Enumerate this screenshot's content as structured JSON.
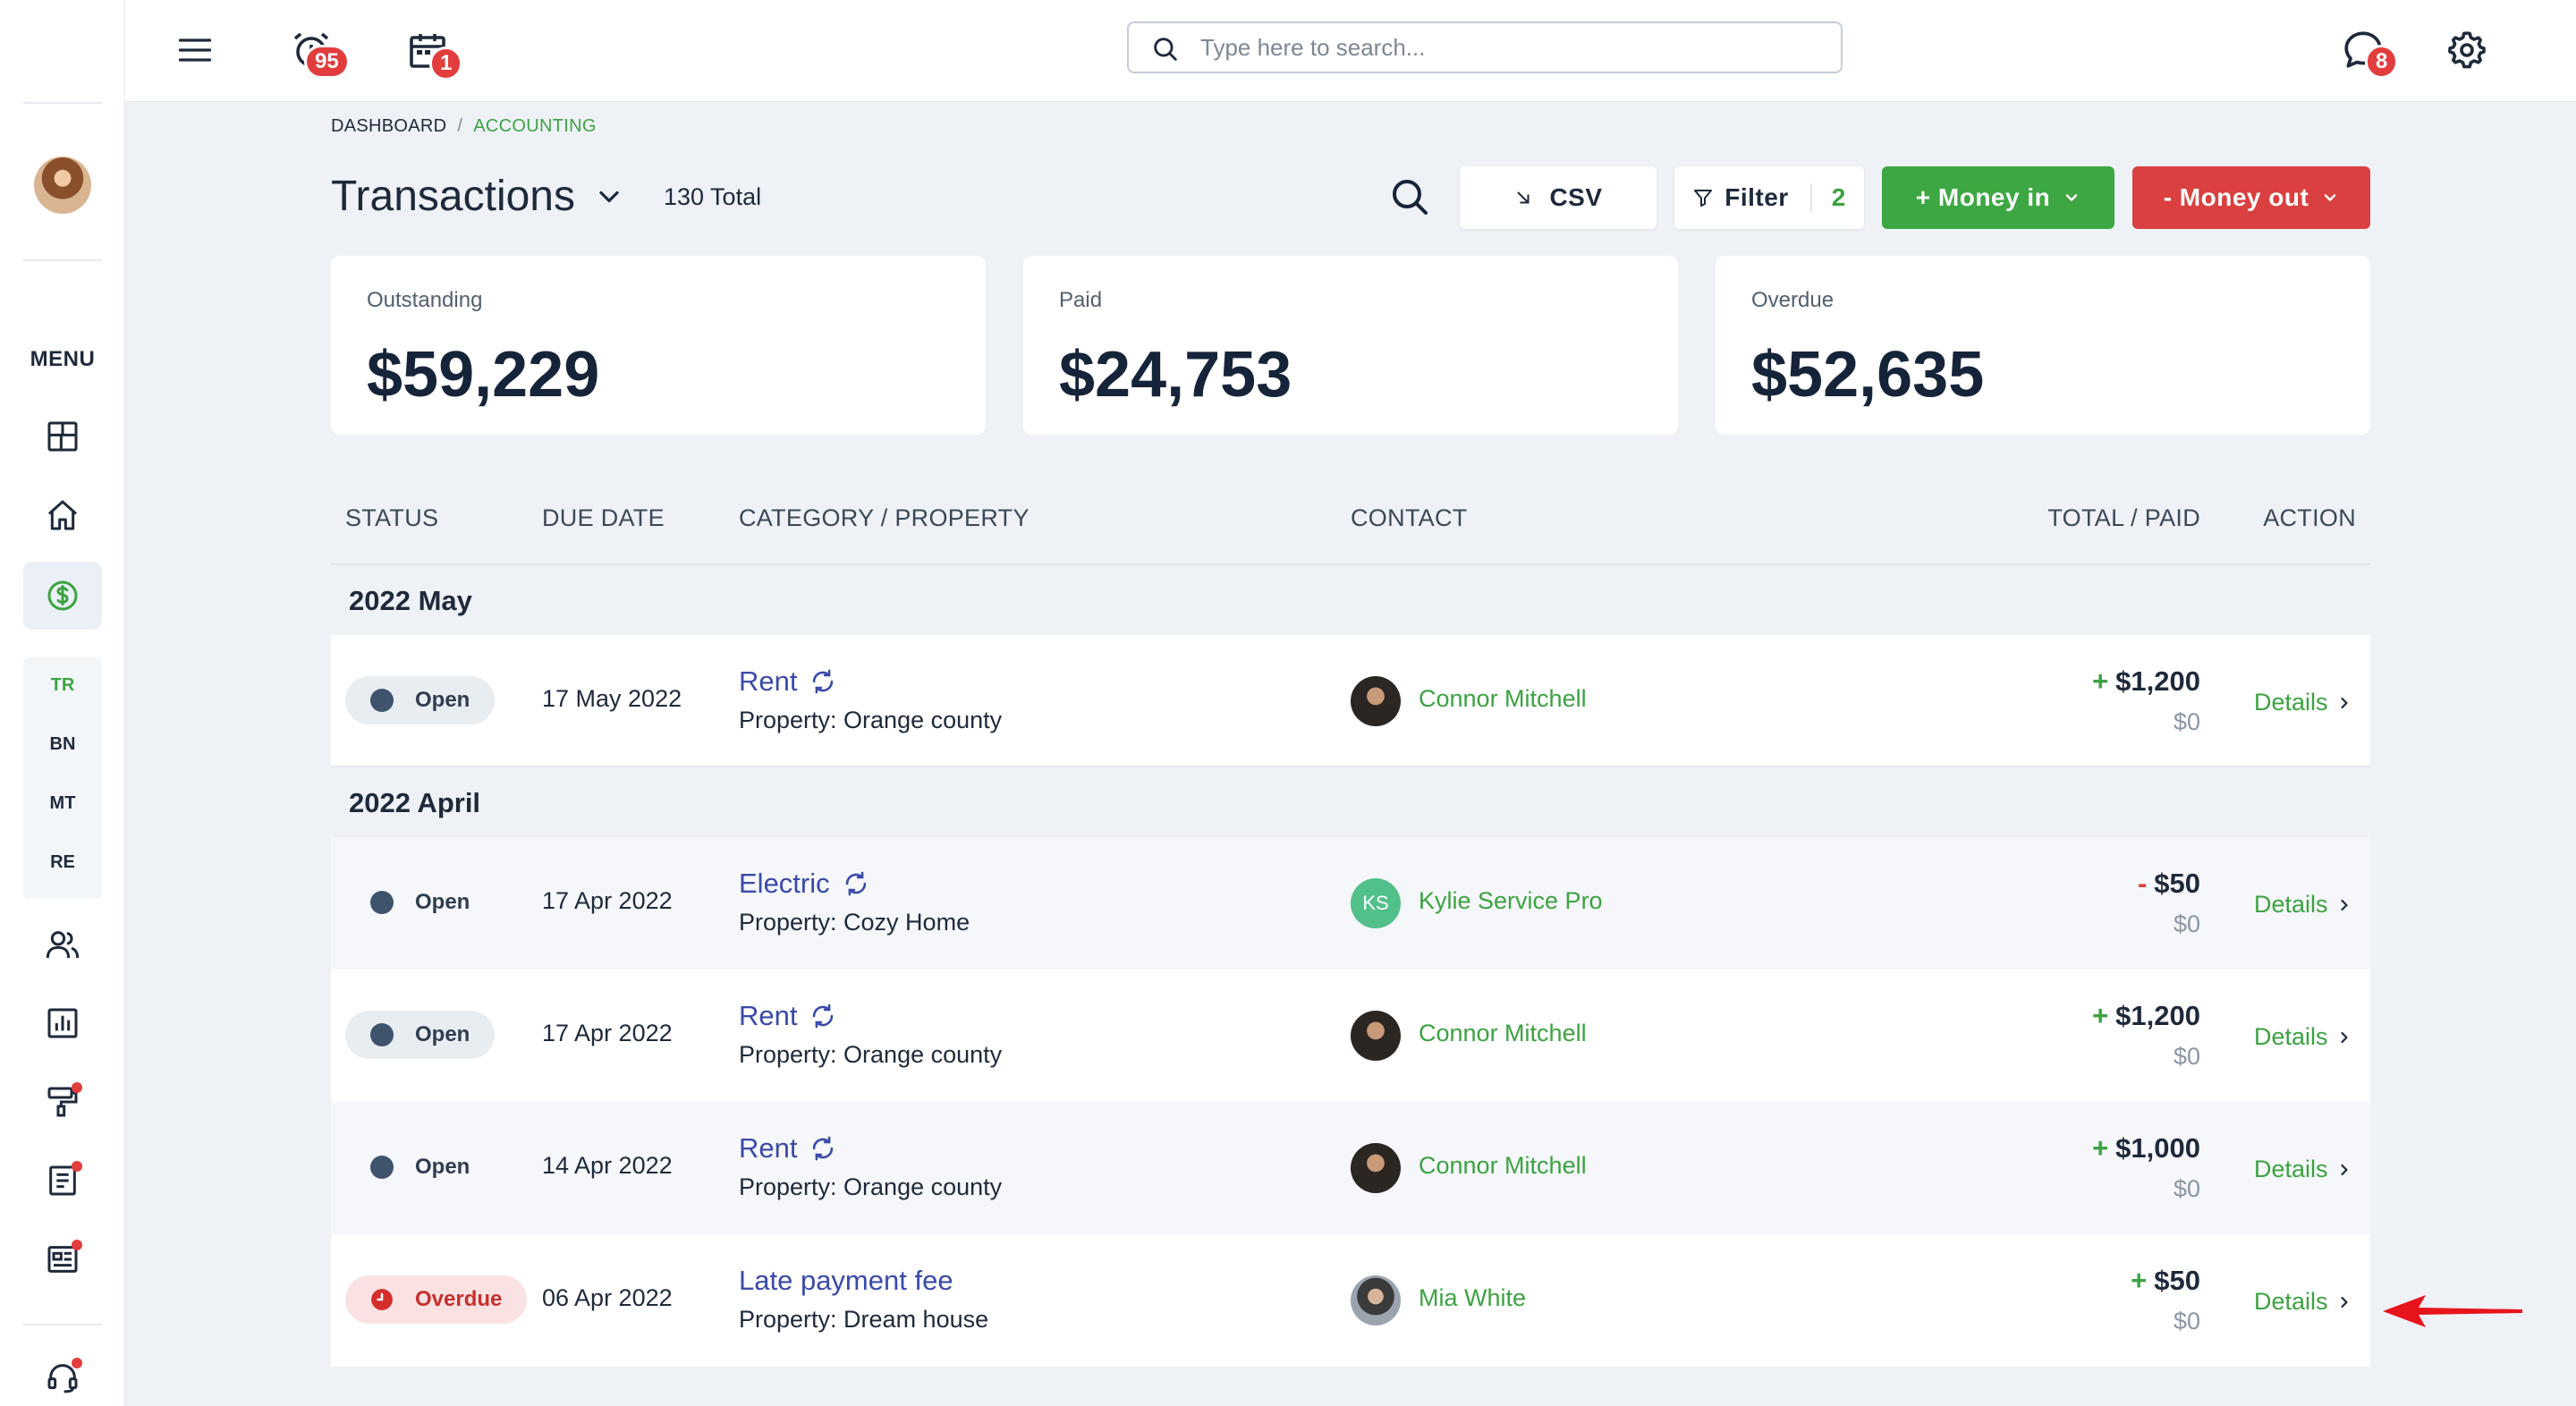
{
  "topbar": {
    "alarm_badge": "95",
    "calendar_badge": "1",
    "chat_badge": "8",
    "search_placeholder": "Type here to search..."
  },
  "sidebar": {
    "menu_label": "MENU",
    "sub_items": [
      "TR",
      "BN",
      "MT",
      "RE"
    ]
  },
  "breadcrumb": {
    "root": "DASHBOARD",
    "separator": "/",
    "current": "ACCOUNTING"
  },
  "header": {
    "title": "Transactions",
    "total": "130 Total",
    "csv_label": "CSV",
    "filter_label": "Filter",
    "filter_count": "2",
    "money_in_label": "+ Money in",
    "money_out_label": "- Money out"
  },
  "cards": [
    {
      "label": "Outstanding",
      "value": "$59,229"
    },
    {
      "label": "Paid",
      "value": "$24,753"
    },
    {
      "label": "Overdue",
      "value": "$52,635"
    }
  ],
  "table": {
    "headers": {
      "status": "STATUS",
      "due_date": "DUE DATE",
      "category": "CATEGORY / PROPERTY",
      "contact": "CONTACT",
      "total": "TOTAL / PAID",
      "action": "ACTION"
    },
    "groups": [
      "2022 May",
      "2022 April"
    ],
    "rows": [
      {
        "status": "Open",
        "due": "17 May 2022",
        "category": "Rent",
        "property": "Property: Orange county",
        "contact": "Connor Mitchell",
        "sign": "+",
        "amount": "$1,200",
        "paid": "$0",
        "action": "Details"
      },
      {
        "status": "Open",
        "due": "17 Apr 2022",
        "category": "Electric",
        "property": "Property: Cozy Home",
        "contact": "Kylie Service Pro",
        "contact_initials": "KS",
        "sign": "-",
        "amount": "$50",
        "paid": "$0",
        "action": "Details"
      },
      {
        "status": "Open",
        "due": "17 Apr 2022",
        "category": "Rent",
        "property": "Property: Orange county",
        "contact": "Connor Mitchell",
        "sign": "+",
        "amount": "$1,200",
        "paid": "$0",
        "action": "Details"
      },
      {
        "status": "Open",
        "due": "14 Apr 2022",
        "category": "Rent",
        "property": "Property: Orange county",
        "contact": "Connor Mitchell",
        "sign": "+",
        "amount": "$1,000",
        "paid": "$0",
        "action": "Details"
      },
      {
        "status": "Overdue",
        "due": "06 Apr 2022",
        "category": "Late payment fee",
        "property": "Property: Dream house",
        "contact": "Mia White",
        "sign": "+",
        "amount": "$50",
        "paid": "$0",
        "action": "Details"
      }
    ]
  },
  "colors": {
    "accent_green": "#3da843",
    "danger_red": "#d9403f",
    "link_blue": "#3a4aa8",
    "background": "#eef2f7"
  }
}
